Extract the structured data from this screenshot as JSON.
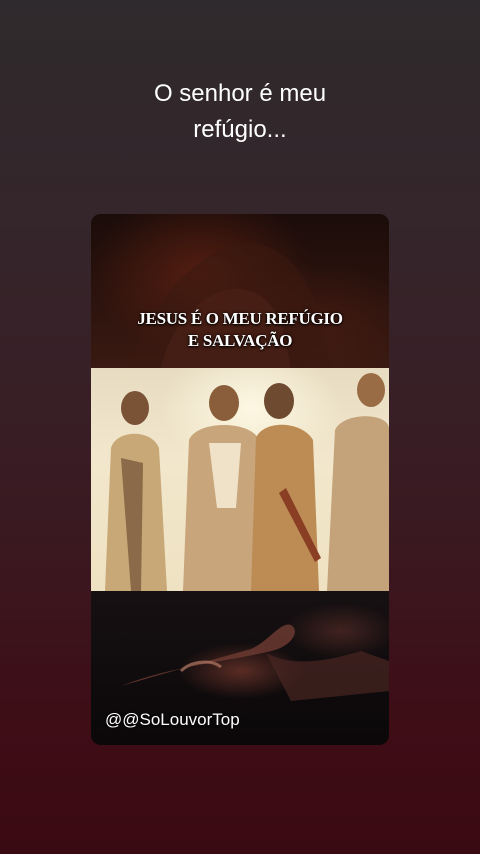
{
  "caption": {
    "line1": "O senhor é meu",
    "line2": "refúgio..."
  },
  "card": {
    "headline": {
      "line1": "JESUS É O MEU REFÚGIO",
      "line2": "E SALVAÇÃO"
    },
    "handle": "@@SoLouvorTop"
  },
  "colors": {
    "background_top": "#2f2a2d",
    "background_bottom": "#3a0a12",
    "text": "#ffffff"
  }
}
